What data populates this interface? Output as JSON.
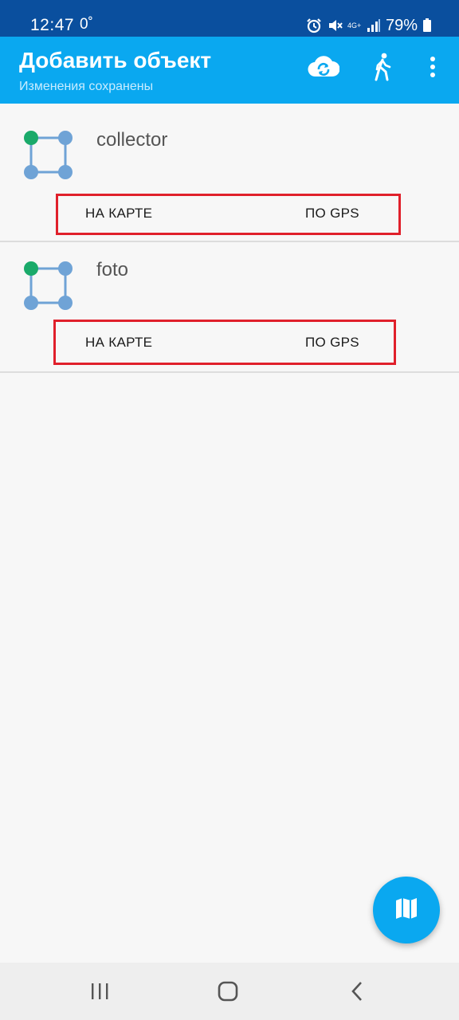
{
  "status_bar": {
    "time": "12:47",
    "temperature": "0˚",
    "battery": "79%",
    "network_label": "4G+"
  },
  "app_bar": {
    "title": "Добавить объект",
    "subtitle": "Изменения сохранены",
    "icons": [
      "cloud-sync-icon",
      "walking-person-icon",
      "more-vert-icon"
    ]
  },
  "items": [
    {
      "title": "collector",
      "on_map_label": "НА КАРТЕ",
      "by_gps_label": "ПО GPS"
    },
    {
      "title": "foto",
      "on_map_label": "НА КАРТЕ",
      "by_gps_label": "ПО GPS"
    }
  ],
  "fab": {
    "icon": "map-icon"
  },
  "nav_bar": {
    "icons": [
      "recent-apps-icon",
      "home-icon",
      "back-icon"
    ]
  },
  "colors": {
    "status_bar": "#0a4f9e",
    "app_bar": "#0aa8f0",
    "highlight_box": "#e0202b",
    "vertex_start": "#1aaa6a",
    "vertex": "#6fa3d6"
  }
}
